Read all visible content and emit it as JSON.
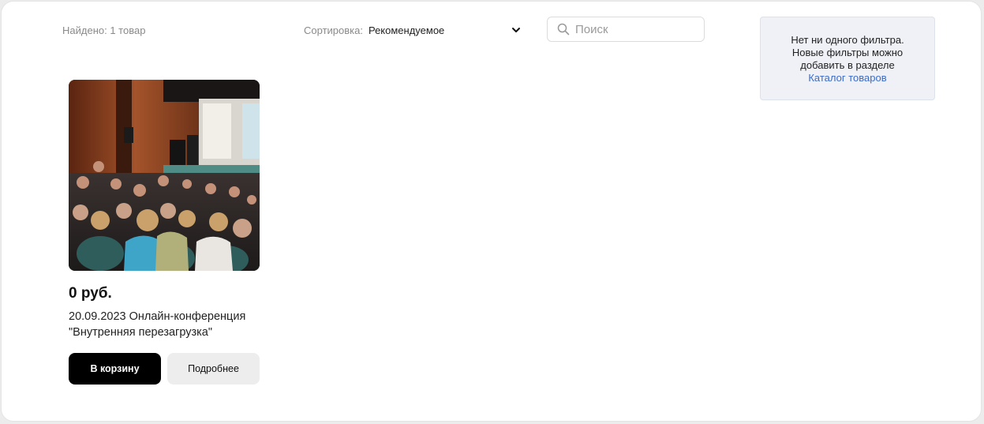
{
  "toolbar": {
    "found_text": "Найдено: 1 товар",
    "sort_label": "Сортировка:",
    "sort_value": "Рекомендуемое",
    "search_placeholder": "Поиск"
  },
  "filters_panel": {
    "line1": "Нет ни одного фильтра.",
    "line2": "Новые фильтры можно",
    "line3": "добавить в разделе",
    "link_text": "Каталог товаров"
  },
  "product": {
    "price": "0 руб.",
    "title": "20.09.2023 Онлайн-конференция \"Внутренняя перезагрузка\"",
    "cart_button": "В корзину",
    "details_button": "Подробнее"
  },
  "icons": {
    "sort": "chevron-down-icon",
    "search": "search-icon"
  },
  "colors": {
    "accent_link": "#3b6bc9",
    "primary_button": "#000000",
    "secondary_button": "#ededed",
    "filters_bg": "#eff1f6"
  }
}
